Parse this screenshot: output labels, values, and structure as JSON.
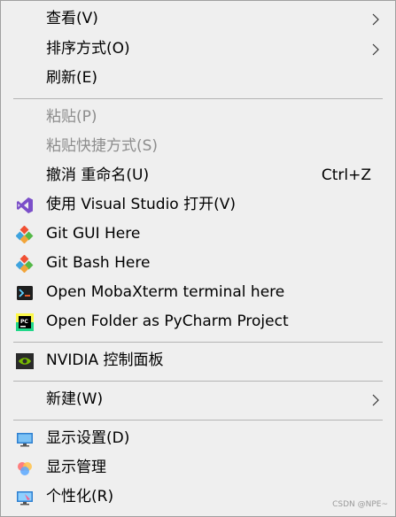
{
  "menu": {
    "items": [
      {
        "label": "查看(V)",
        "submenu": true
      },
      {
        "label": "排序方式(O)",
        "submenu": true
      },
      {
        "label": "刷新(E)"
      },
      {
        "label": "粘贴(P)",
        "disabled": true
      },
      {
        "label": "粘贴快捷方式(S)",
        "disabled": true
      },
      {
        "label": "撤消 重命名(U)",
        "shortcut": "Ctrl+Z"
      },
      {
        "label": "使用 Visual Studio 打开(V)",
        "icon": "visual-studio-icon"
      },
      {
        "label": "Git GUI Here",
        "icon": "git-icon"
      },
      {
        "label": "Git Bash Here",
        "icon": "git-icon"
      },
      {
        "label": "Open MobaXterm terminal here",
        "icon": "mobaxterm-icon"
      },
      {
        "label": "Open Folder as PyCharm Project",
        "icon": "pycharm-icon"
      },
      {
        "label": "NVIDIA 控制面板",
        "icon": "nvidia-icon"
      },
      {
        "label": "新建(W)",
        "submenu": true
      },
      {
        "label": "显示设置(D)",
        "icon": "display-settings-icon"
      },
      {
        "label": "显示管理",
        "icon": "display-manager-icon"
      },
      {
        "label": "个性化(R)",
        "icon": "personalize-icon"
      }
    ]
  },
  "watermark": "CSDN @NPE~",
  "colors": {
    "background": "#efefef",
    "disabled_text": "#8d8d8d",
    "separator": "#b4b4b4"
  }
}
